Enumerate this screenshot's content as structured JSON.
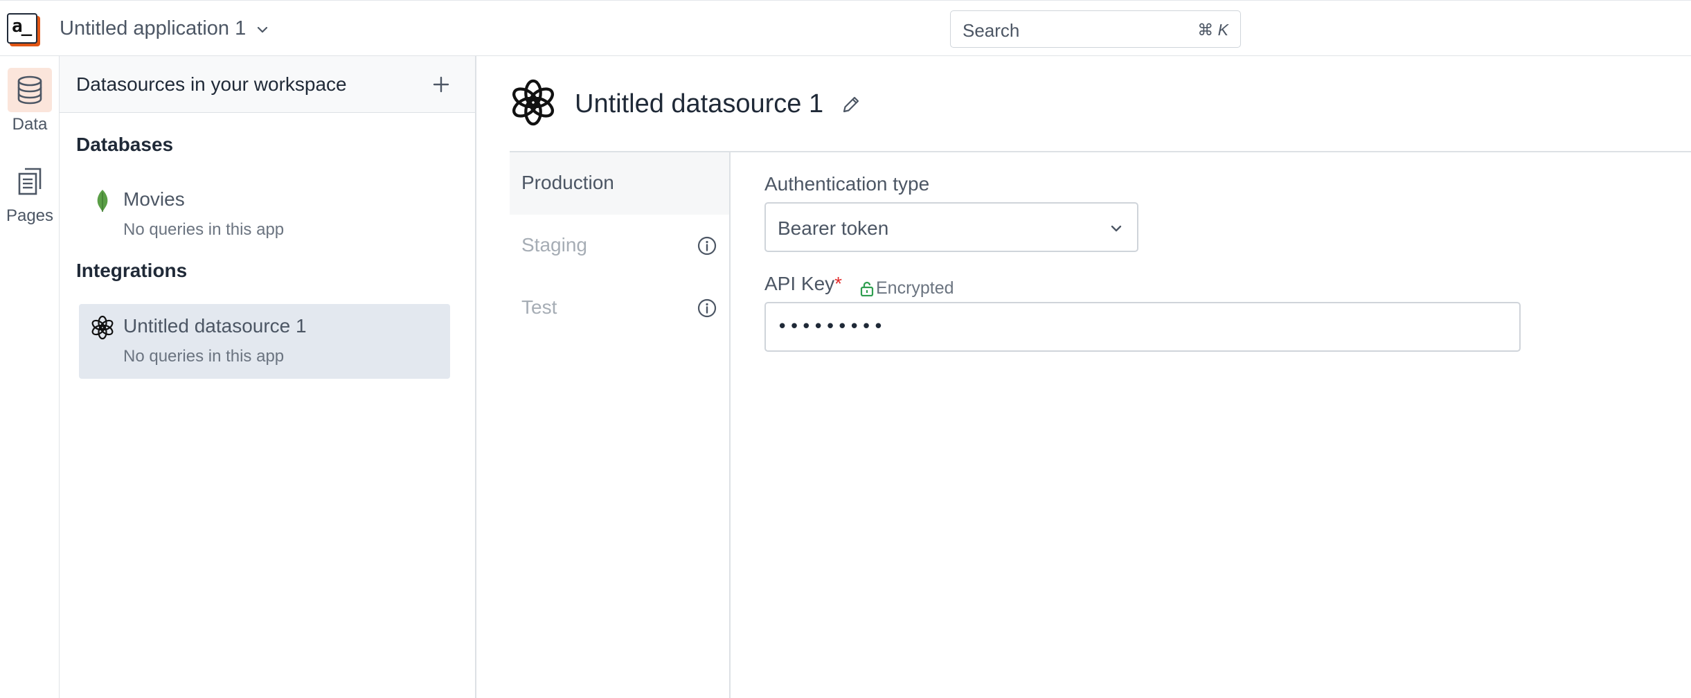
{
  "header": {
    "logo_text": "a_",
    "app_title": "Untitled application 1",
    "search_placeholder": "Search",
    "search_shortcut_symbol": "⌘",
    "search_shortcut_key": "K"
  },
  "rail": {
    "items": [
      {
        "label": "Data",
        "icon": "database-icon",
        "active": true
      },
      {
        "label": "Pages",
        "icon": "pages-icon",
        "active": false
      }
    ]
  },
  "datasources": {
    "title": "Datasources in your workspace",
    "sections": [
      {
        "title": "Databases",
        "items": [
          {
            "name": "Movies",
            "subtitle": "No queries in this app",
            "icon": "mongodb-leaf-icon"
          }
        ]
      },
      {
        "title": "Integrations",
        "items": [
          {
            "name": "Untitled datasource 1",
            "subtitle": "No queries in this app",
            "icon": "openai-icon",
            "active": true
          }
        ]
      }
    ]
  },
  "main": {
    "title": "Untitled datasource 1",
    "environments": [
      {
        "label": "Production",
        "active": true
      },
      {
        "label": "Staging",
        "active": false
      },
      {
        "label": "Test",
        "active": false
      }
    ],
    "form": {
      "auth_label": "Authentication type",
      "auth_value": "Bearer token",
      "api_key_label": "API Key",
      "required_mark": "*",
      "encrypted_label": "Encrypted",
      "api_key_value": "•••••••••"
    }
  },
  "colors": {
    "accent": "#e15615",
    "active_rail_bg": "#fbe5db",
    "active_item_bg": "#e3e8ef",
    "encrypted_green": "#2e9e4f",
    "required_red": "#e22d2d"
  }
}
